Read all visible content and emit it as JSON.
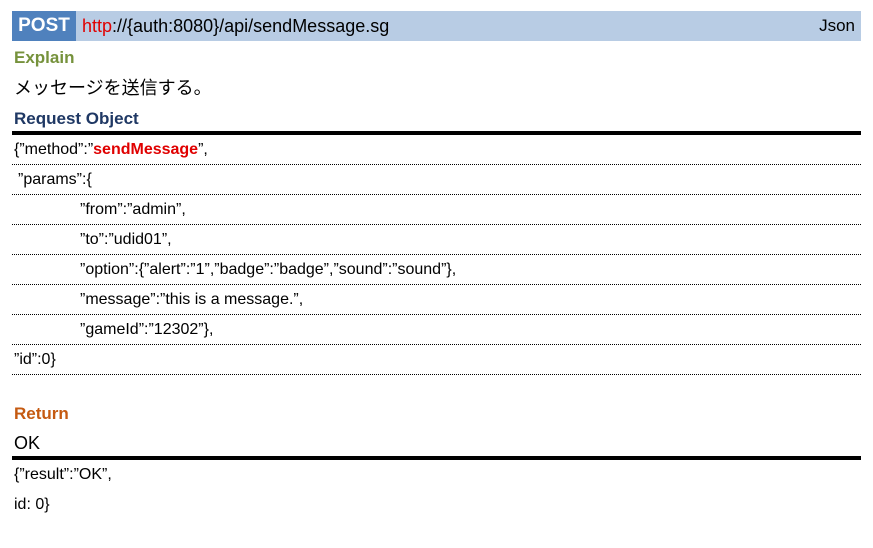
{
  "header": {
    "method": "POST",
    "url_scheme": "http",
    "url_rest": "://{auth:8080}/api/sendMessage.sg",
    "format": "Json"
  },
  "explain": {
    "heading": "Explain",
    "text": "メッセージを送信する。"
  },
  "request": {
    "heading": "Request Object",
    "line1_prefix": "{”method”:”",
    "line1_method": "sendMessage",
    "line1_suffix": "”,",
    "lines": [
      "”params”:{",
      "”from”:”admin”,",
      "”to”:”udid01”,",
      "”option”:{”alert”:”1”,”badge”:”badge”,”sound”:”sound”},",
      "”message”:”this is a message.”,",
      "”gameId”:”12302”},",
      "”id”:0}"
    ]
  },
  "return": {
    "heading": "Return",
    "status": "OK",
    "lines": [
      "{”result”:”OK”,",
      "id: 0}"
    ]
  }
}
